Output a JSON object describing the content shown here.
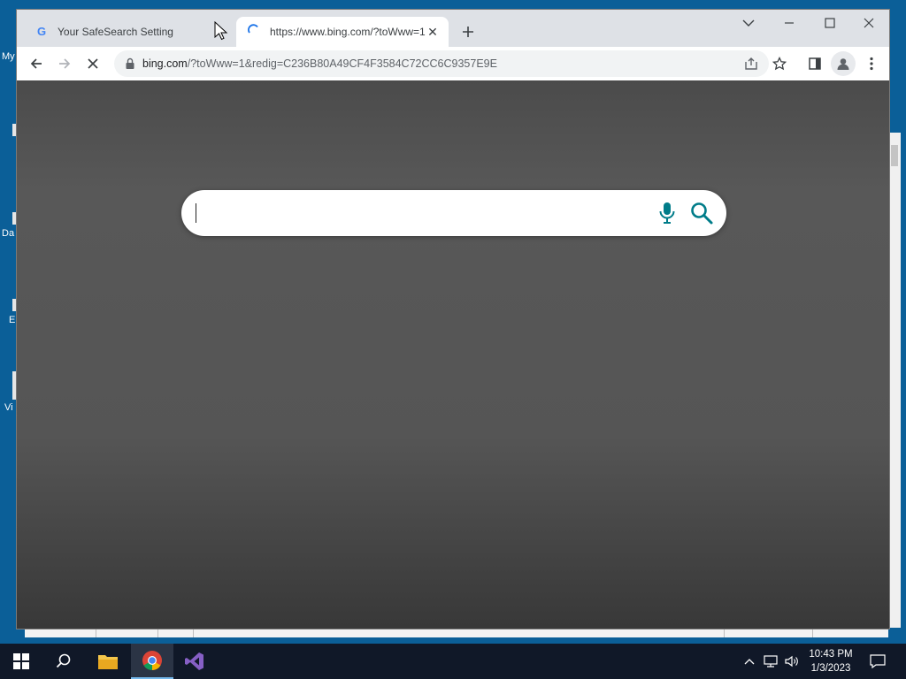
{
  "desktop": {
    "labels": [
      "My",
      "Da",
      "E",
      "Vi"
    ]
  },
  "browser": {
    "tabs": [
      {
        "title": "Your SafeSearch Setting",
        "icon": "google-g-icon",
        "active": false
      },
      {
        "title": "https://www.bing.com/?toWww=1",
        "icon": "loading-spinner-icon",
        "active": true
      }
    ],
    "address": {
      "host": "bing.com",
      "path": "/?toWww=1&redig=C236B80A49CF4F3584C72CC6C9357E9E"
    },
    "page": {
      "search_value": "",
      "mic_icon": "microphone-icon",
      "search_icon": "search-icon",
      "accent_color": "#007c89"
    }
  },
  "taskbar": {
    "time": "10:43 PM",
    "date": "1/3/2023",
    "apps": [
      "file-explorer-icon",
      "chrome-icon",
      "visual-studio-icon"
    ]
  }
}
